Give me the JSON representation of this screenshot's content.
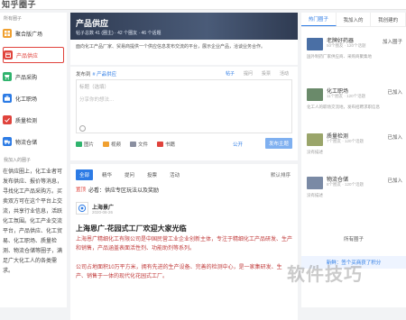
{
  "topbar": {
    "logo": "知乎圈子"
  },
  "sidebar": {
    "section_title": "所有圈子",
    "items": [
      {
        "label": "聚合版广场",
        "icon": "grid-icon",
        "color": "#f0a030"
      },
      {
        "label": "产品供应",
        "icon": "box-icon",
        "color": "#e0433c",
        "active": true
      },
      {
        "label": "产品采购",
        "icon": "cart-icon",
        "color": "#2fb36d"
      },
      {
        "label": "化工职场",
        "icon": "briefcase-icon",
        "color": "#2c7be5"
      },
      {
        "label": "质量检测",
        "icon": "check-icon",
        "color": "#e0433c"
      },
      {
        "label": "物流仓储",
        "icon": "truck-icon",
        "color": "#2c7be5"
      }
    ],
    "sub_title": "我加入的圈子",
    "desc": "在供应圈上，化工业者可发布供应、报价等消息，寻找化工产品采购方。买卖双方可在这个平台上交流，共享行业信息，活跃化工氛围。化工产业交流平台，产品供应、化工贸易、化工职场、质量检测、物流仓储等圈子，满足广大化工人的各类需求。"
  },
  "main": {
    "banner": {
      "title": "产品供应",
      "stats": "帖子总数 41 (圈主) · 42 个圈友 · 46 个话题"
    },
    "intro": "面向化工产品厂家、贸易商提供一个供应信息发布交流的平台，展示企业产品，洽谈业务合作。",
    "publish": {
      "to_label": "发布到",
      "circle_tag": "# 产品供应",
      "tabs": [
        "帖子",
        "提问",
        "投票",
        "活动"
      ],
      "title_placeholder": "标题（选填）",
      "content_placeholder": "分享你的想法…",
      "tools": [
        {
          "label": "图片",
          "color": "#2fb36d"
        },
        {
          "label": "视频",
          "color": "#f0a030"
        },
        {
          "label": "文件",
          "color": "#8a8fa0"
        },
        {
          "label": "书籍",
          "color": "#e0433c"
        }
      ],
      "public_label": "公开",
      "submit_label": "发布主题"
    },
    "feed": {
      "tabs": [
        "全部",
        "精华",
        "提问",
        "投票",
        "活动"
      ],
      "sort_label": "默认排序",
      "notice_badge": "置顶",
      "notice_text": "必看：供应专区玩法以及奖励",
      "post": {
        "author": "上海景广",
        "time": "2020-08-26",
        "title": "上海恩广-花园式工厂欢迎大家光临",
        "body": "上海恩广精细化工有限公司是中国民营工业企业创新主体，专注于精细化工产品研发、生产和销售，产品涵盖表面活性剂、功能助剂等系列。",
        "body2": "公司占地面积10万平方米，拥有先进的生产设备、完善的检测中心，是一家集研发、生产、销售于一体的现代化花园式工厂。"
      }
    }
  },
  "right": {
    "tabs": [
      "热门圈子",
      "我加入的",
      "我创建的"
    ],
    "groups": [
      {
        "name": "老牌好药器",
        "meta": "50个圈友 · 120个话题",
        "join": "加入圈子",
        "desc": "国外制药厂家供应商、采购商聚集地",
        "color": "#4a6fa5"
      },
      {
        "name": "化工职场",
        "meta": "11个圈友 · 120个话题",
        "join": "已加入",
        "desc": "化工人的职场交流地，发布招聘求职信息",
        "color": "#6a8a6a"
      },
      {
        "name": "质量检测",
        "meta": "7个圈友 · 120个话题",
        "join": "已加入",
        "desc": "没有描述",
        "color": "#9aa56a"
      },
      {
        "name": "物流仓储",
        "meta": "8个圈友 · 120个话题",
        "join": "已加入",
        "desc": "没有描述",
        "color": "#7a8aa5"
      }
    ],
    "all_groups": "所有圈子",
    "ad": "新鲜：签个买商获了积分"
  },
  "watermark": "软件技巧"
}
